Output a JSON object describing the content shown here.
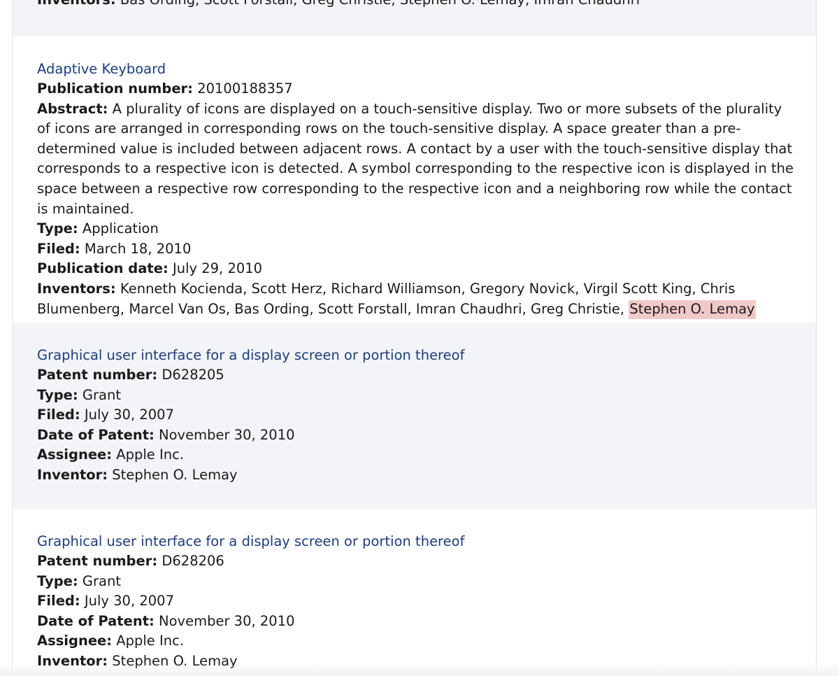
{
  "prev_entry": {
    "inventors_label": "Inventors:",
    "inventors_value": "Bas Ording, Scott Forstall, Greg Christie, Stephen O. Lemay, Imran Chaudhri"
  },
  "entry_adaptive": {
    "title": "Adaptive Keyboard",
    "publication_number_label": "Publication number:",
    "publication_number": "20100188357",
    "abstract_label": "Abstract:",
    "abstract": "A plurality of icons are displayed on a touch-sensitive display. Two or more subsets of the plurality of icons are arranged in corresponding rows on the touch-sensitive display. A space greater than a pre-determined value is included between adjacent rows. A contact by a user with the touch-sensitive display that corresponds to a respective icon is detected. A symbol corresponding to the respective icon is displayed in the space between a respective row corresponding to the respective icon and a neighboring row while the contact is maintained.",
    "type_label": "Type:",
    "type": "Application",
    "filed_label": "Filed:",
    "filed": "March 18, 2010",
    "publication_date_label": "Publication date:",
    "publication_date": "July 29, 2010",
    "inventors_label": "Inventors:",
    "inventors_value": "Kenneth Kocienda, Scott Herz, Richard Williamson, Gregory Novick, Virgil Scott King, Chris Blumenberg, Marcel Van Os, Bas Ording, Scott Forstall, Imran Chaudhri, Greg Christie,",
    "inventors_highlight": "Stephen O. Lemay"
  },
  "entry_d628205": {
    "title": "Graphical user interface for a display screen or portion thereof",
    "patent_number_label": "Patent number:",
    "patent_number": "D628205",
    "type_label": "Type:",
    "type": "Grant",
    "filed_label": "Filed:",
    "filed": "July 30, 2007",
    "date_of_patent_label": "Date of Patent:",
    "date_of_patent": "November 30, 2010",
    "assignee_label": "Assignee:",
    "assignee": "Apple Inc.",
    "inventor_label": "Inventor:",
    "inventor": "Stephen O. Lemay"
  },
  "entry_d628206": {
    "title": "Graphical user interface for a display screen or portion thereof",
    "patent_number_label": "Patent number:",
    "patent_number": "D628206",
    "type_label": "Type:",
    "type": "Grant",
    "filed_label": "Filed:",
    "filed": "July 30, 2007",
    "date_of_patent_label": "Date of Patent:",
    "date_of_patent": "November 30, 2010",
    "assignee_label": "Assignee:",
    "assignee": "Apple Inc.",
    "inventor_label": "Inventor:",
    "inventor": "Stephen O. Lemay"
  },
  "colors": {
    "link": "#1d3c7a",
    "alt_background": "#f2f4f7",
    "highlight": "#f2c9c9"
  }
}
